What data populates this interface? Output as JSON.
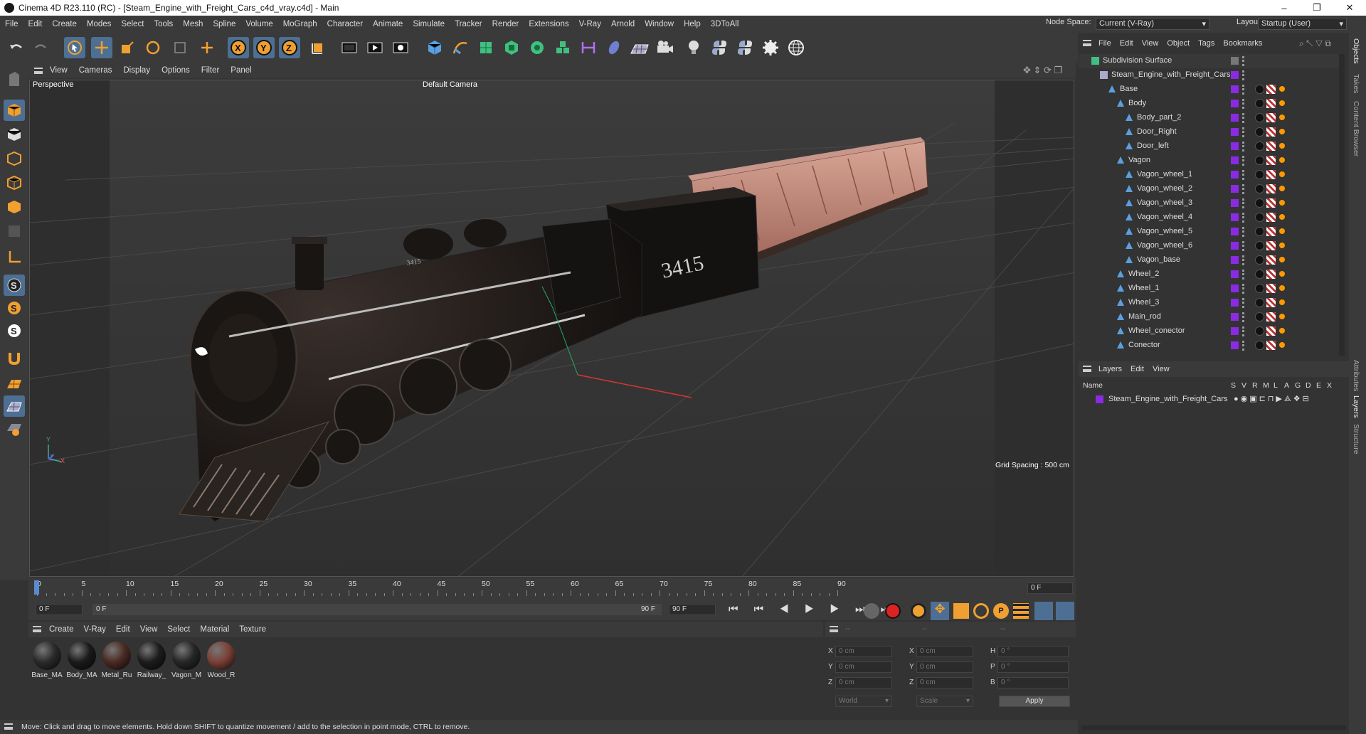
{
  "window": {
    "title": "Cinema 4D R23.110 (RC) - [Steam_Engine_with_Freight_Cars_c4d_vray.c4d] - Main",
    "controls": [
      "–",
      "❐",
      "✕"
    ]
  },
  "menu": [
    "File",
    "Edit",
    "Create",
    "Modes",
    "Select",
    "Tools",
    "Mesh",
    "Spline",
    "Volume",
    "MoGraph",
    "Character",
    "Animate",
    "Simulate",
    "Tracker",
    "Render",
    "Extensions",
    "V-Ray",
    "Arnold",
    "Window",
    "Help",
    "3DToAll"
  ],
  "node_space": {
    "label": "Node Space:",
    "value": "Current (V-Ray)"
  },
  "layout": {
    "label": "Layout:",
    "value": "Startup (User)"
  },
  "viewport": {
    "menu": [
      "View",
      "Cameras",
      "Display",
      "Options",
      "Filter",
      "Panel"
    ],
    "perspective": "Perspective",
    "camera": "Default Camera",
    "grid_spacing": "Grid Spacing : 500 cm",
    "axis_labels": {
      "y": "Y",
      "z": "Z",
      "x": "X"
    },
    "loco_number": "3415"
  },
  "timeline": {
    "ticks": [
      "0",
      "5",
      "10",
      "15",
      "20",
      "25",
      "30",
      "35",
      "40",
      "45",
      "50",
      "55",
      "60",
      "65",
      "70",
      "75",
      "80",
      "85",
      "90"
    ],
    "current_frame": "0 F"
  },
  "playbar": {
    "start": "0 F",
    "range_start": "0 F",
    "range_end": "90 F",
    "end": "90 F"
  },
  "materials": {
    "menu": [
      "Create",
      "V-Ray",
      "Edit",
      "View",
      "Select",
      "Material",
      "Texture"
    ],
    "items": [
      {
        "label": "Base_MA",
        "color": "#2a2a2a"
      },
      {
        "label": "Body_MA",
        "color": "#1a1a1a"
      },
      {
        "label": "Metal_Ru",
        "color": "#4a2a22"
      },
      {
        "label": "Railway_",
        "color": "#1c1c1c"
      },
      {
        "label": "Vagon_M",
        "color": "#262626"
      },
      {
        "label": "Wood_R",
        "color": "#7a4035"
      }
    ]
  },
  "coords": {
    "header": [
      "--",
      "--",
      "--"
    ],
    "rows": [
      {
        "a": "X",
        "av": "0 cm",
        "b": "X",
        "bv": "0 cm",
        "c": "H",
        "cv": "0 °"
      },
      {
        "a": "Y",
        "av": "0 cm",
        "b": "Y",
        "bv": "0 cm",
        "c": "P",
        "cv": "0 °"
      },
      {
        "a": "Z",
        "av": "0 cm",
        "b": "Z",
        "bv": "0 cm",
        "c": "B",
        "cv": "0 °"
      }
    ],
    "mode1": "World",
    "mode2": "Scale",
    "apply": "Apply"
  },
  "status": "Move: Click and drag to move elements. Hold down SHIFT to quantize movement / add to the selection in point mode, CTRL to remove.",
  "objects": {
    "menu": [
      "File",
      "Edit",
      "View",
      "Object",
      "Tags",
      "Bookmarks"
    ],
    "rows": [
      {
        "name": "Subdivision Surface",
        "indent": 0
      },
      {
        "name": "Steam_Engine_with_Freight_Cars",
        "indent": 1
      },
      {
        "name": "Base",
        "indent": 2
      },
      {
        "name": "Body",
        "indent": 3
      },
      {
        "name": "Body_part_2",
        "indent": 4
      },
      {
        "name": "Door_Right",
        "indent": 4
      },
      {
        "name": "Door_left",
        "indent": 4
      },
      {
        "name": "Vagon",
        "indent": 3
      },
      {
        "name": "Vagon_wheel_1",
        "indent": 4
      },
      {
        "name": "Vagon_wheel_2",
        "indent": 4
      },
      {
        "name": "Vagon_wheel_3",
        "indent": 4
      },
      {
        "name": "Vagon_wheel_4",
        "indent": 4
      },
      {
        "name": "Vagon_wheel_5",
        "indent": 4
      },
      {
        "name": "Vagon_wheel_6",
        "indent": 4
      },
      {
        "name": "Vagon_base",
        "indent": 4
      },
      {
        "name": "Wheel_2",
        "indent": 3
      },
      {
        "name": "Wheel_1",
        "indent": 3
      },
      {
        "name": "Wheel_3",
        "indent": 3
      },
      {
        "name": "Main_rod",
        "indent": 3
      },
      {
        "name": "Wheel_conector",
        "indent": 3
      },
      {
        "name": "Conector",
        "indent": 3
      }
    ]
  },
  "layers": {
    "menu": [
      "Layers",
      "Edit",
      "View"
    ],
    "col_name": "Name",
    "cols": [
      "S",
      "V",
      "R",
      "M",
      "L",
      "A",
      "G",
      "D",
      "E",
      "X"
    ],
    "items": [
      {
        "name": "Steam_Engine_with_Freight_Cars"
      }
    ]
  },
  "right_tabs": [
    "Objects",
    "Takes",
    "Content Browser",
    "Attributes",
    "Layers",
    "Structure"
  ]
}
